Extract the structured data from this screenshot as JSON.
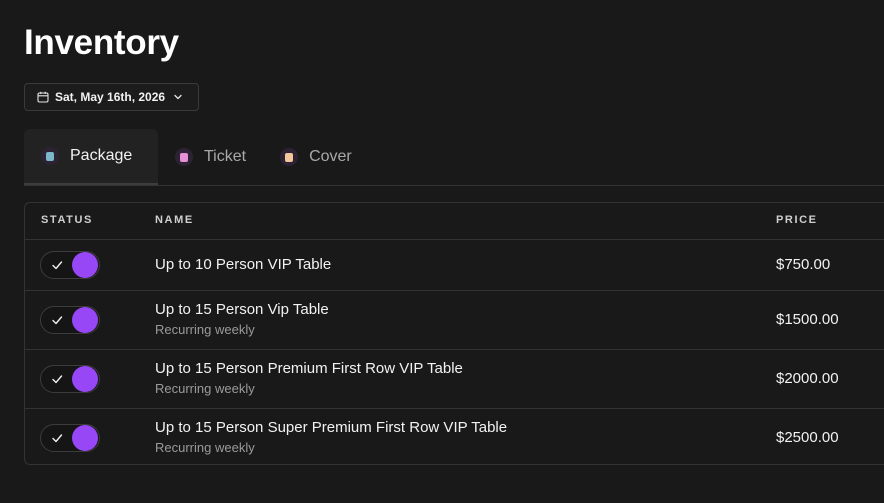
{
  "page": {
    "title": "Inventory"
  },
  "date_picker": {
    "label": "Sat, May 16th, 2026"
  },
  "tabs": [
    {
      "label": "Package",
      "active": true,
      "icon": "package-icon",
      "color": "#7bb7c9"
    },
    {
      "label": "Ticket",
      "active": false,
      "icon": "ticket-icon",
      "color": "#e48fd6"
    },
    {
      "label": "Cover",
      "active": false,
      "icon": "cover-icon",
      "color": "#f3c79a"
    }
  ],
  "table": {
    "headers": {
      "status": "STATUS",
      "name": "NAME",
      "price": "PRICE"
    },
    "rows": [
      {
        "enabled": true,
        "name": "Up to 10 Person VIP Table",
        "subtitle": "",
        "price": "$750.00"
      },
      {
        "enabled": true,
        "name": "Up to 15 Person Vip Table",
        "subtitle": "Recurring weekly",
        "price": "$1500.00"
      },
      {
        "enabled": true,
        "name": "Up to 15 Person Premium First Row VIP Table",
        "subtitle": "Recurring weekly",
        "price": "$2000.00"
      },
      {
        "enabled": true,
        "name": "Up to 15 Person Super Premium First Row VIP Table",
        "subtitle": "Recurring weekly",
        "price": "$2500.00"
      }
    ]
  },
  "colors": {
    "background": "#191919",
    "accent": "#9747f5",
    "border": "#333333"
  }
}
